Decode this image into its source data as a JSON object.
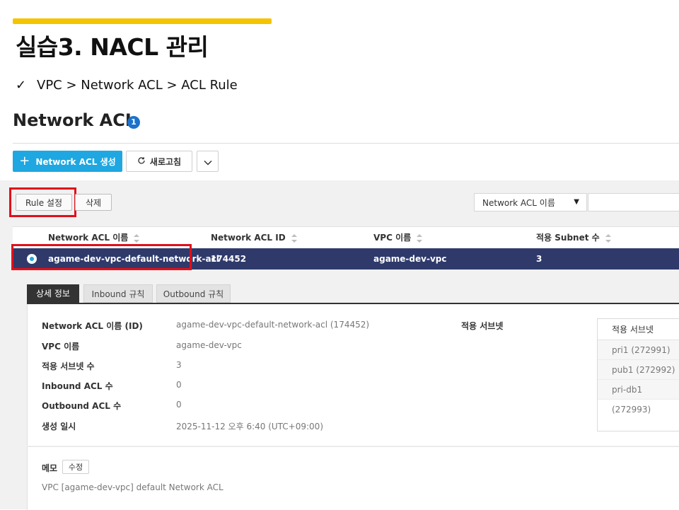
{
  "slide": {
    "title": "실습3. NACL 관리",
    "breadcrumb_check": "✓",
    "breadcrumb": "VPC > Network ACL > ACL Rule",
    "accent_color": "#f5c400"
  },
  "page": {
    "heading": "Network ACL",
    "info_badge": "1"
  },
  "toolbar": {
    "create_label": "Network ACL 생성",
    "create_icon": "plus-icon",
    "refresh_label": "새로고침",
    "refresh_icon": "refresh-icon",
    "more_icon": "chevron-down-icon"
  },
  "actions": {
    "rule_label": "Rule 설정",
    "delete_label": "삭제"
  },
  "filter": {
    "selected": "Network ACL 이름",
    "search_value": ""
  },
  "table": {
    "columns": [
      "Network ACL 이름",
      "Network ACL ID",
      "VPC 이름",
      "적용 Subnet 수"
    ],
    "rows": [
      {
        "name": "agame-dev-vpc-default-network-acl",
        "id": "174452",
        "vpc": "agame-dev-vpc",
        "subnet_count": "3",
        "selected": true
      }
    ],
    "selected_row_color": "#2f3a6b"
  },
  "tabs": [
    "상세 정보",
    "Inbound 규칙",
    "Outbound 규칙"
  ],
  "details": {
    "fields": [
      {
        "label": "Network ACL 이름 (ID)",
        "value": "agame-dev-vpc-default-network-acl (174452)"
      },
      {
        "label": "VPC 이름",
        "value": "agame-dev-vpc"
      },
      {
        "label": "적용 서브넷 수",
        "value": "3"
      },
      {
        "label": "Inbound ACL 수",
        "value": "0"
      },
      {
        "label": "Outbound ACL 수",
        "value": "0"
      },
      {
        "label": "생성 일시",
        "value": "2025-11-12 오후 6:40 (UTC+09:00)"
      }
    ],
    "subnet_heading": "적용 서브넷",
    "subnet_table_header": "적용 서브넷",
    "subnets": [
      "pri1 (272991)",
      "pub1 (272992)",
      "pri-db1 (272993)"
    ]
  },
  "memo": {
    "label": "메모",
    "edit_label": "수정",
    "text": "VPC [agame-dev-vpc] default Network ACL"
  },
  "colors": {
    "primary": "#1ea7e1",
    "highlight": "#e0101a",
    "badge": "#1d72c9"
  }
}
